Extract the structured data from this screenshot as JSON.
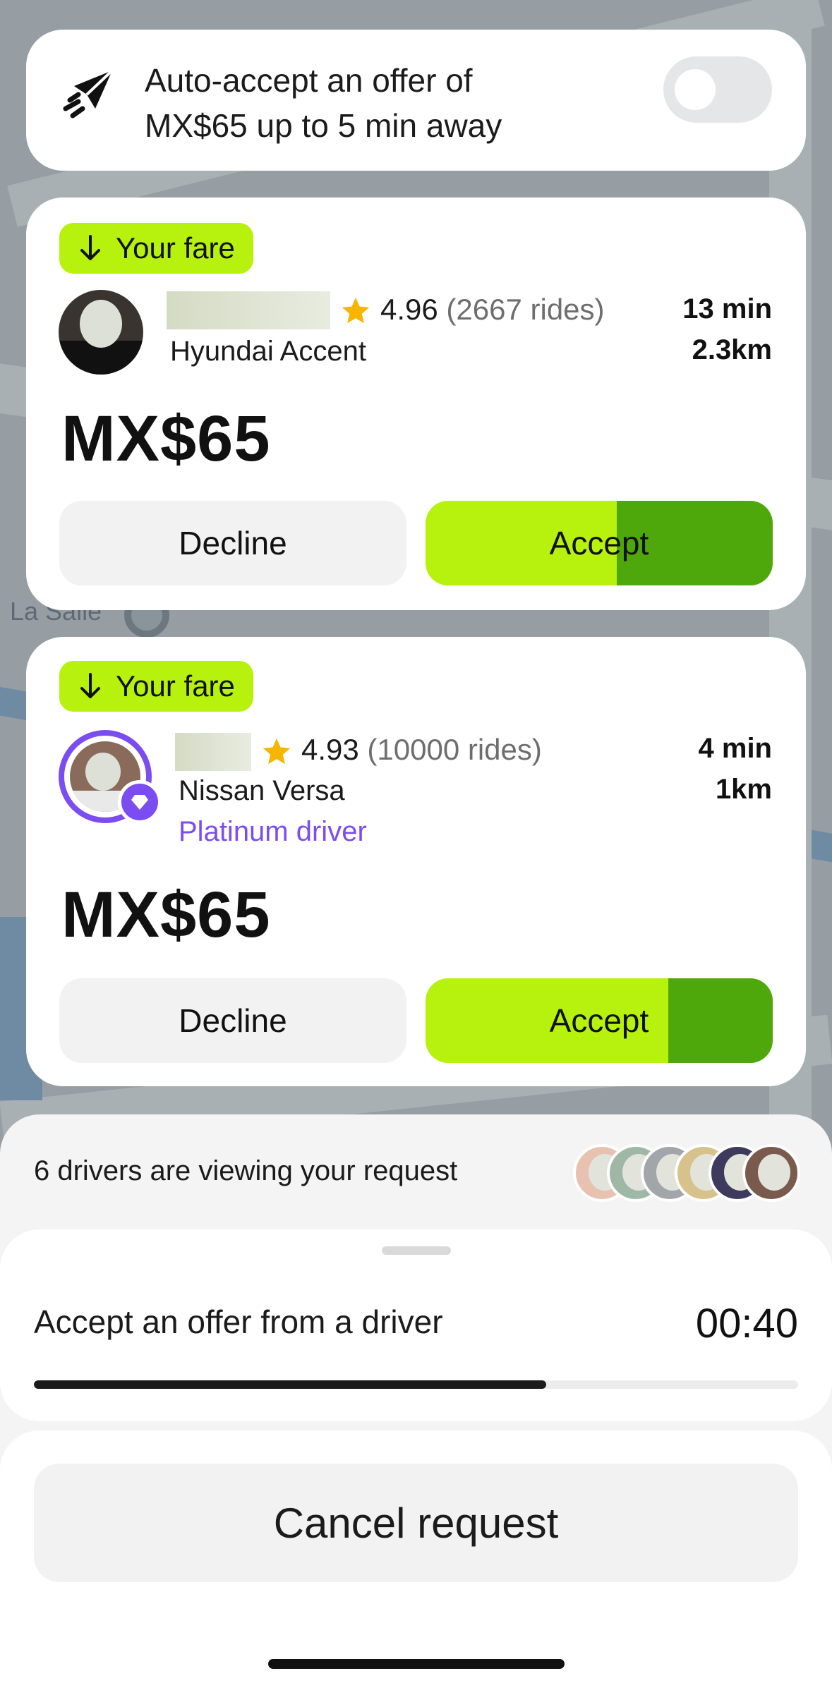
{
  "auto_accept": {
    "icon": "paper-plane-fast-icon",
    "line1": "Auto-accept an offer of",
    "line2": "MX$65 up to 5 min away",
    "enabled": false
  },
  "offers": [
    {
      "tag": "Your fare",
      "rating": "4.96",
      "rides": "(2667 rides)",
      "car": "Hyundai Accent",
      "eta_time": "13 min",
      "eta_distance": "2.3km",
      "price": "MX$65",
      "decline_label": "Decline",
      "accept_label": "Accept",
      "accept_countdown_fraction": 0.45
    },
    {
      "tag": "Your fare",
      "rating": "4.93",
      "rides": "(10000 rides)",
      "car": "Nissan Versa",
      "status": "Platinum driver",
      "eta_time": "4 min",
      "eta_distance": "1km",
      "price": "MX$65",
      "decline_label": "Decline",
      "accept_label": "Accept",
      "accept_countdown_fraction": 0.3
    }
  ],
  "map_labels": {
    "street": "La Salle"
  },
  "viewers": {
    "text": "6 drivers are viewing your request",
    "count": 6
  },
  "timer": {
    "label": "Accept an offer from a driver",
    "value": "00:40",
    "progress_fraction": 0.67
  },
  "cancel_label": "Cancel request",
  "colors": {
    "accent_green": "#b6f20d",
    "dark_green": "#4fa80b",
    "platinum_purple": "#7b4cf2",
    "star_yellow": "#f7b500"
  }
}
